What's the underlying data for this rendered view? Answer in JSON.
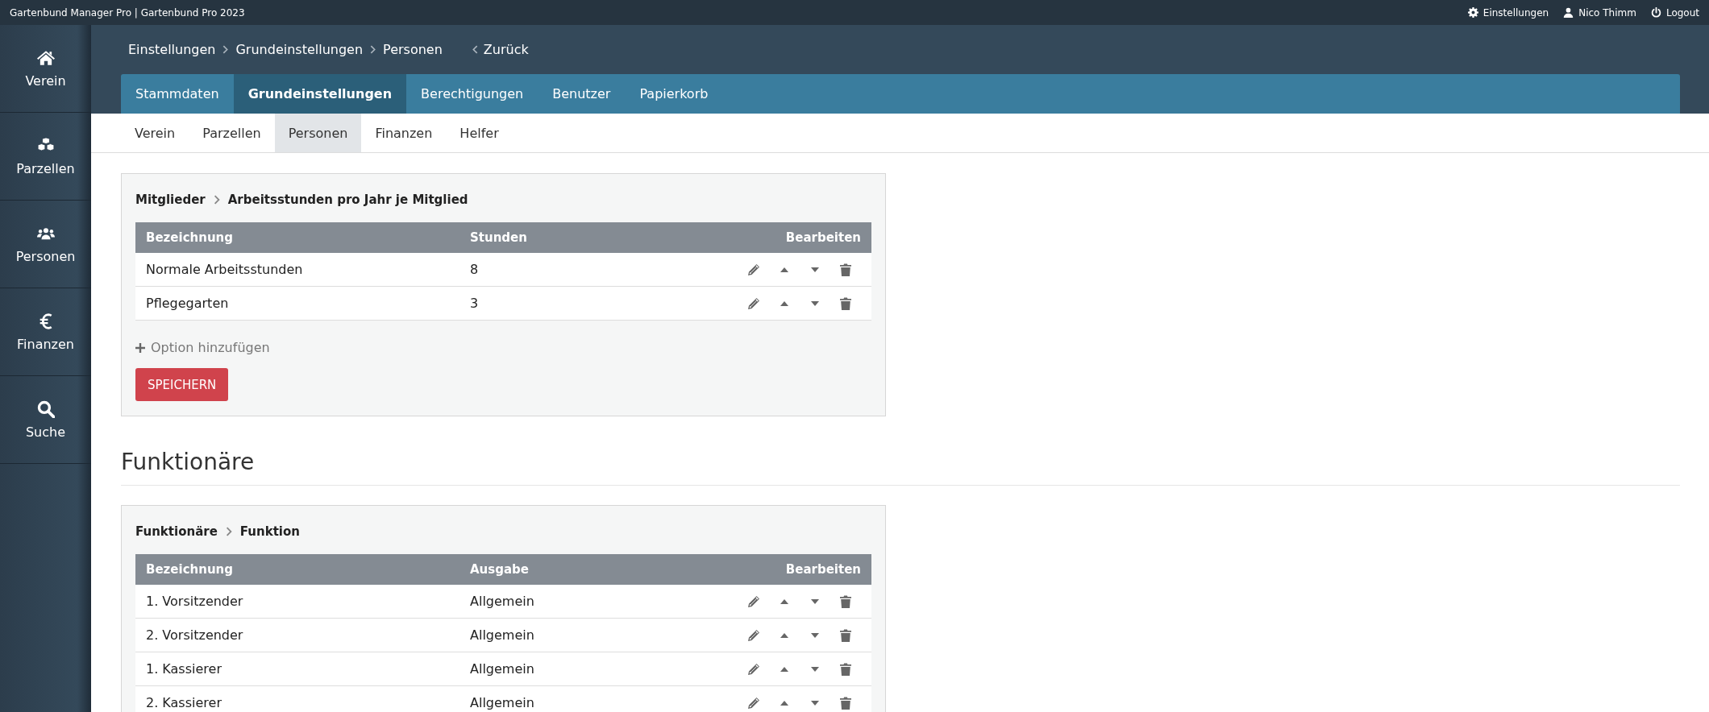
{
  "top_bar": {
    "title": "Gartenbund Manager Pro | Gartenbund Pro 2023",
    "links": [
      {
        "kind": "gear",
        "label": "Einstellungen"
      },
      {
        "kind": "user",
        "label": "Nico Thimm"
      },
      {
        "kind": "power",
        "label": "Logout"
      }
    ]
  },
  "sidebar": {
    "items": [
      {
        "kind": "home",
        "label": "Verein"
      },
      {
        "kind": "cubes",
        "label": "Parzellen"
      },
      {
        "kind": "users",
        "label": "Personen"
      },
      {
        "kind": "euro",
        "label": "Finanzen"
      },
      {
        "kind": "search",
        "label": "Suche"
      }
    ]
  },
  "breadcrumb": {
    "items": [
      "Einstellungen",
      "Grundeinstellungen",
      "Personen"
    ],
    "back": "Zurück"
  },
  "tabs": [
    {
      "label": "Stammdaten",
      "selected": false
    },
    {
      "label": "Grundeinstellungen",
      "selected": true
    },
    {
      "label": "Berechtigungen",
      "selected": false
    },
    {
      "label": "Benutzer",
      "selected": false
    },
    {
      "label": "Papierkorb",
      "selected": false
    }
  ],
  "subtabs": [
    {
      "label": "Verein",
      "selected": false
    },
    {
      "label": "Parzellen",
      "selected": false
    },
    {
      "label": "Personen",
      "selected": true
    },
    {
      "label": "Finanzen",
      "selected": false
    },
    {
      "label": "Helfer",
      "selected": false
    }
  ],
  "sections": [
    {
      "card": {
        "path": [
          "Mitglieder",
          "Arbeitsstunden pro Jahr je Mitglied"
        ],
        "columns": [
          "Bezeichnung",
          "Stunden",
          "Bearbeiten"
        ],
        "rows": [
          [
            "Normale Arbeitsstunden",
            "8"
          ],
          [
            "Pflegegarten",
            "3"
          ]
        ],
        "add_option": "Option hinzufügen",
        "save_button": "SPEICHERN"
      }
    },
    {
      "heading": "Funktionäre",
      "card": {
        "path": [
          "Funktionäre",
          "Funktion"
        ],
        "columns": [
          "Bezeichnung",
          "Ausgabe",
          "Bearbeiten"
        ],
        "rows": [
          [
            "1. Vorsitzender",
            "Allgemein"
          ],
          [
            "2. Vorsitzender",
            "Allgemein"
          ],
          [
            "1. Kassierer",
            "Allgemein"
          ],
          [
            "2. Kassierer",
            "Allgemein"
          ]
        ]
      }
    }
  ]
}
